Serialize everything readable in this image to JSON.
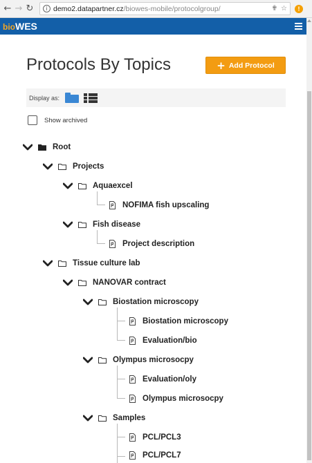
{
  "browser": {
    "url_domain": "demo2.datapartner.cz",
    "url_path": "/biowes-mobile/protocolgroup/",
    "info_glyph": "i",
    "ext_glyph": "!"
  },
  "app": {
    "brand_prefix": "bio",
    "brand_name": "WES"
  },
  "page": {
    "title": "Protocols By Topics",
    "add_button_label": "Add Protocol",
    "display_as_label": "Display as:",
    "show_archived_label": "Show archived"
  },
  "tree": {
    "root": "Root",
    "projects": "Projects",
    "aquaexcel": "Aquaexcel",
    "nofima": "NOFIMA fish upscaling",
    "fish_disease": "Fish disease",
    "project_description": "Project description",
    "tissue_culture_lab": "Tissue culture lab",
    "nanovar_contract": "NANOVAR contract",
    "biostation_folder": "Biostation microscopy",
    "biostation_file": "Biostation microscopy",
    "evaluation_bio": "Evaluation/bio",
    "olympus_folder": "Olympus microsocpy",
    "evaluation_oly": "Evaluation/oly",
    "olympus_file": "Olympus microsocpy",
    "samples": "Samples",
    "pcl3": "PCL/PCL3",
    "pcl7": "PCL/PCL7"
  },
  "colors": {
    "appbar": "#135fa8",
    "brand_accent": "#f5a623",
    "button": "#f39c12",
    "view_icon": "#3a87d4"
  }
}
